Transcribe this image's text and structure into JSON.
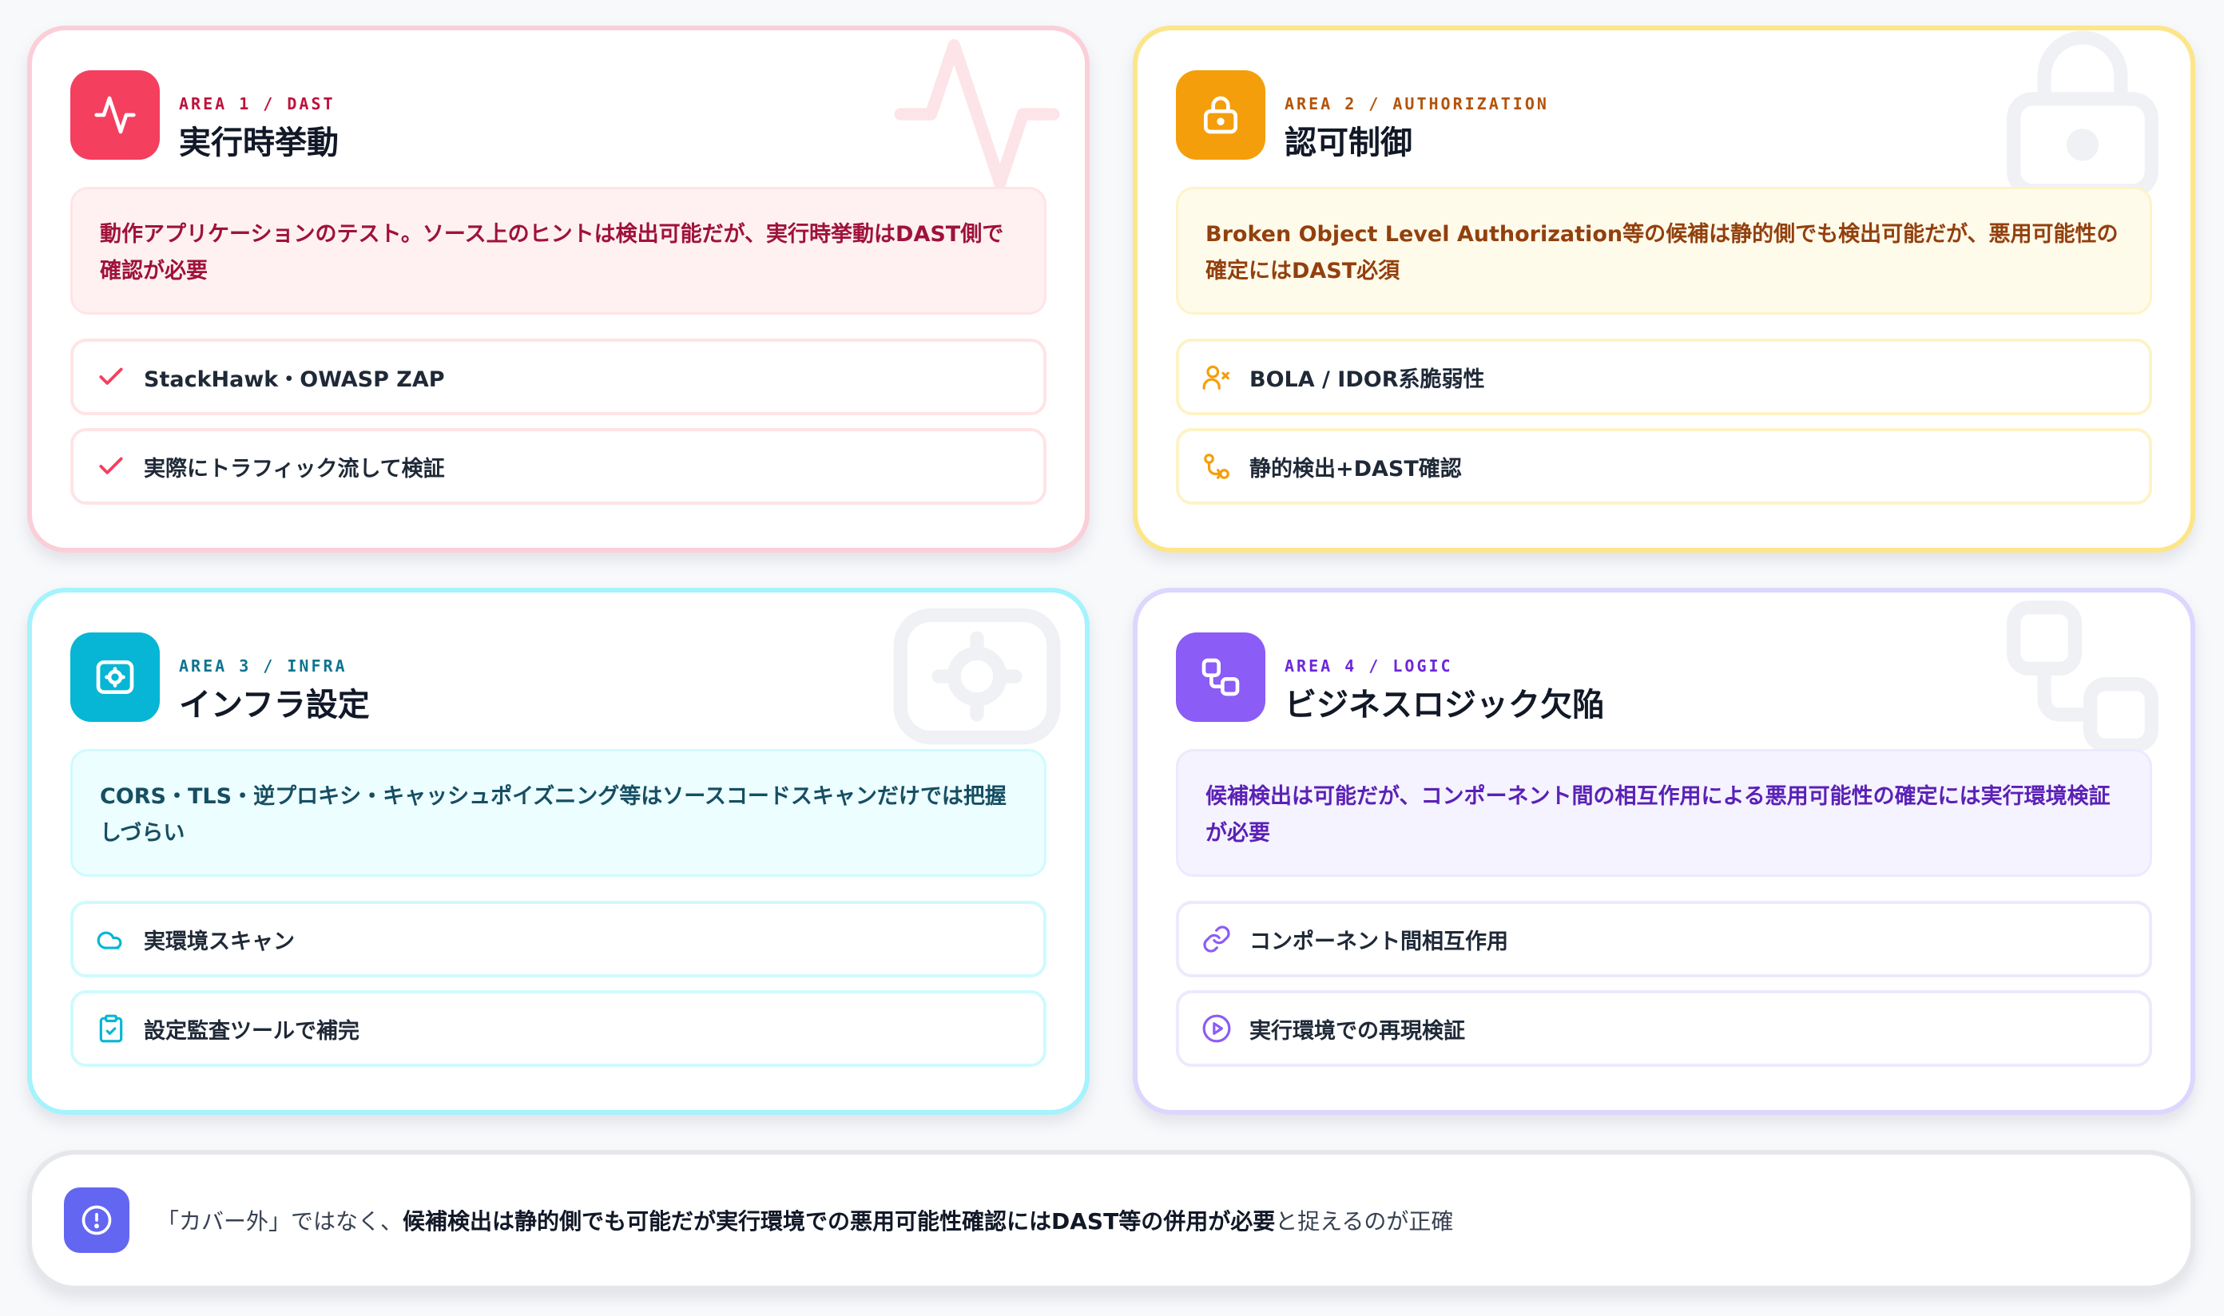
{
  "cards": [
    {
      "area_label": "AREA 1 / DAST",
      "title": "実行時挙動",
      "description": "動作アプリケーションのテスト。ソース上のヒントは検出可能だが、実行時挙動はDAST側で確認が必要",
      "items": [
        {
          "icon": "check-icon",
          "label": "StackHawk・OWASP ZAP"
        },
        {
          "icon": "check-icon",
          "label": "実際にトラフィック流して検証"
        }
      ],
      "accent": "#f43f5e"
    },
    {
      "area_label": "AREA 2 / AUTHORIZATION",
      "title": "認可制御",
      "description": "Broken Object Level Authorization等の候補は静的側でも検出可能だが、悪用可能性の確定にはDAST必須",
      "items": [
        {
          "icon": "user-x-icon",
          "label": "BOLA / IDOR系脆弱性"
        },
        {
          "icon": "git-compare-icon",
          "label": "静的検出+DAST確認"
        }
      ],
      "accent": "#f59e0b"
    },
    {
      "area_label": "AREA 3 / INFRA",
      "title": "インフラ設定",
      "description": "CORS・TLS・逆プロキシ・キャッシュポイズニング等はソースコードスキャンだけでは把握しづらい",
      "items": [
        {
          "icon": "cloud-icon",
          "label": "実環境スキャン"
        },
        {
          "icon": "clipboard-check-icon",
          "label": "設定監査ツールで補完"
        }
      ],
      "accent": "#06b6d4"
    },
    {
      "area_label": "AREA 4 / LOGIC",
      "title": "ビジネスロジック欠陥",
      "description": "候補検出は可能だが、コンポーネント間の相互作用による悪用可能性の確定には実行環境検証が必要",
      "items": [
        {
          "icon": "link-icon",
          "label": "コンポーネント間相互作用"
        },
        {
          "icon": "play-circle-icon",
          "label": "実行環境での再現検証"
        }
      ],
      "accent": "#8b5cf6"
    }
  ],
  "note": {
    "prefix": "「カバー外」ではなく、",
    "emphasis": "候補検出は静的側でも可能だが実行環境での悪用可能性確認にはDAST等の併用が必要",
    "suffix": "と捉えるのが正確",
    "accent": "#6366f1"
  }
}
